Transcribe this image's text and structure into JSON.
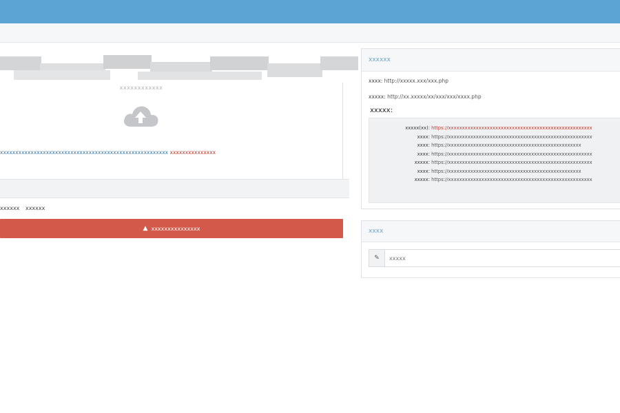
{
  "upload": {
    "hint": "xxxxxxxxxxxx",
    "notice_text": "xxxxxxxxxxxxxxxxxxxxxxxxxxxxxxxxxxxxxxxxxxxxxxxxxxxxxxx",
    "notice_red": "xxxxxxxxxxxxxxx"
  },
  "links": [
    "xxxxxx",
    "xxxxxx"
  ],
  "warning": {
    "label": "xxxxxxxxxxxxxxx",
    "icon": "warning-triangle-icon"
  },
  "info_panel": {
    "title": "xxxxxx",
    "rows": [
      {
        "key": "xxxx:",
        "value": "http://xxxxx.xxx/xxx.php"
      },
      {
        "key": "xxxxx:",
        "value": "http://xx.xxxxx/xx/xxx/xxx/xxxx.php"
      }
    ],
    "sub_title": "xxxxx:",
    "url_lines": [
      {
        "key": "xxxxx(xx):",
        "value": "https://xxxxxxxxxxxxxxxxxxxxxxxxxxxxxxxxxxxxxxxxxxxxxxxxxxxx",
        "red": true
      },
      {
        "key": "xxxx:",
        "value": "https://xxxxxxxxxxxxxxxxxxxxxxxxxxxxxxxxxxxxxxxxxxxxxxxxxxxx",
        "red": false
      },
      {
        "key": "xxxx:",
        "value": "https://xxxxxxxxxxxxxxxxxxxxxxxxxxxxxxxxxxxxxxxxxxxxxxxx",
        "red": false
      },
      {
        "key": "xxxx:",
        "value": "https://xxxxxxxxxxxxxxxxxxxxxxxxxxxxxxxxxxxxxxxxxxxxxxxxxxxx",
        "red": false
      },
      {
        "key": "xxxxx:",
        "value": "https://xxxxxxxxxxxxxxxxxxxxxxxxxxxxxxxxxxxxxxxxxxxxxxxxxxxx",
        "red": false
      },
      {
        "key": "xxxx:",
        "value": "https://xxxxxxxxxxxxxxxxxxxxxxxxxxxxxxxxxxxxxxxxxxxxxxxx",
        "red": false
      },
      {
        "key": "xxxxx:",
        "value": "https://xxxxxxxxxxxxxxxxxxxxxxxxxxxxxxxxxxxxxxxxxxxxxxxxxxxx",
        "red": false
      }
    ]
  },
  "search_panel": {
    "title": "xxxx",
    "placeholder": "xxxxx",
    "icon": "search-icon"
  },
  "colors": {
    "top_bar": "#5aa5d3",
    "accent_link": "#3a78a8",
    "warning": "#d35a4a",
    "red_text": "#c0392b"
  }
}
